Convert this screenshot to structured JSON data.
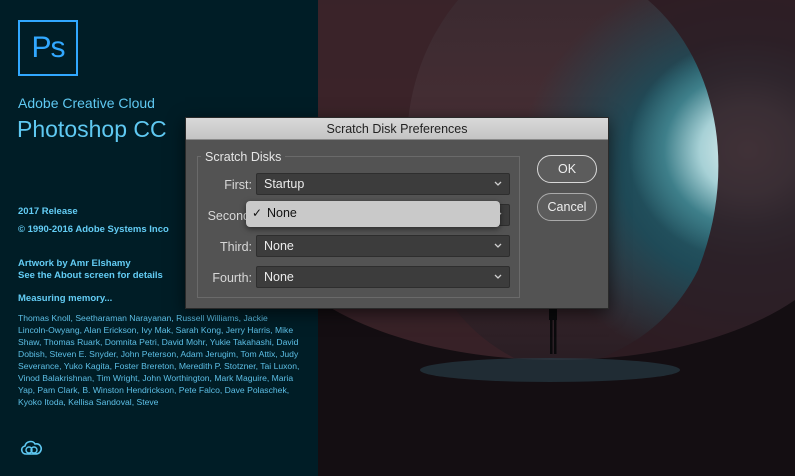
{
  "splash": {
    "logo_text": "Ps",
    "brand_line1": "Adobe Creative Cloud",
    "brand_line2": "Photoshop CC",
    "release": "2017 Release",
    "copyright": "© 1990-2016 Adobe Systems Inco",
    "artwork_by": "Artwork by Amr Elshamy",
    "about_link": "See the About screen for details",
    "measuring": "Measuring memory...",
    "credits": "Thomas Knoll, Seetharaman Narayanan, Russell Williams, Jackie Lincoln-Owyang, Alan Erickson, Ivy Mak, Sarah Kong, Jerry Harris, Mike Shaw, Thomas Ruark, Domnita Petri, David Mohr, Yukie Takahashi, David Dobish, Steven E. Snyder, John Peterson, Adam Jerugim, Tom Attix, Judy Severance, Yuko Kagita, Foster Brereton, Meredith P. Stotzner, Tai Luxon, Vinod Balakrishnan, Tim Wright, John Worthington, Mark Maguire, Maria Yap, Pam Clark, B. Winston Hendrickson, Pete Falco, Dave Polaschek, Kyoko Itoda, Kellisa Sandoval, Steve",
    "cc_icon": "creative-cloud-icon"
  },
  "dialog": {
    "title": "Scratch Disk Preferences",
    "group_label": "Scratch Disks",
    "rows": [
      {
        "label": "First:",
        "value": "Startup"
      },
      {
        "label": "Second",
        "value": "None"
      },
      {
        "label": "Third:",
        "value": "None"
      },
      {
        "label": "Fourth:",
        "value": "None"
      }
    ],
    "popup": {
      "checkmark": "✓",
      "selected": "None"
    },
    "ok_label": "OK",
    "cancel_label": "Cancel"
  },
  "colors": {
    "splash_bg": "#001d26",
    "ps_blue": "#31a8ff",
    "dialog_bg": "#535353"
  }
}
